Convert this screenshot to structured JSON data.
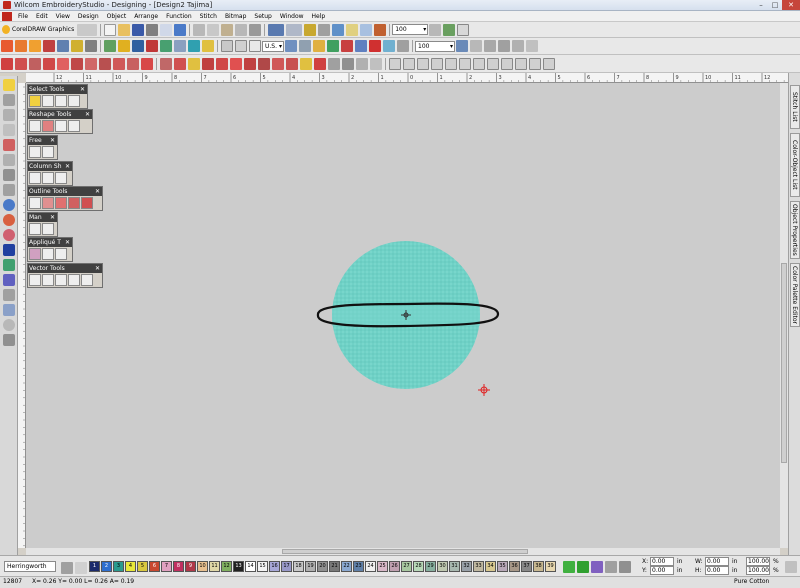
{
  "window": {
    "title": "Wilcom EmbroideryStudio - Designing - [Design2        Tajima]"
  },
  "menu": [
    "File",
    "Edit",
    "View",
    "Design",
    "Object",
    "Arrange",
    "Function",
    "Stitch",
    "Bitmap",
    "Setup",
    "Window",
    "Help"
  ],
  "toolbar": {
    "corel_label": "CorelDRAW Graphics",
    "zoom_value": "100",
    "units_value": "U.S.",
    "scale_value": "100"
  },
  "ruler": {
    "ticks": [
      "12",
      "11",
      "10",
      "9",
      "8",
      "7",
      "6",
      "5",
      "4",
      "3",
      "2",
      "1",
      "0",
      "1",
      "2",
      "3",
      "4",
      "5",
      "6",
      "7",
      "8",
      "9",
      "10",
      "11",
      "12"
    ]
  },
  "panels": [
    {
      "title": "Select Tools",
      "tools": 4
    },
    {
      "title": "Reshape Tools",
      "tools": 4
    },
    {
      "title": "Free",
      "tools": 2
    },
    {
      "title": "Column Sh",
      "tools": 3
    },
    {
      "title": "Outline Tools",
      "tools": 5
    },
    {
      "title": "Man",
      "tools": 2
    },
    {
      "title": "Appliqué T",
      "tools": 3
    },
    {
      "title": "Vector Tools",
      "tools": 5
    }
  ],
  "dock_tabs": [
    "Stitch List",
    "Color-Object List",
    "Object Properties",
    "Color Palette Editor"
  ],
  "fabric": {
    "value": "Herringworth"
  },
  "palette": [
    {
      "num": "1",
      "color": "#1b2a6b"
    },
    {
      "num": "2",
      "color": "#2f6fcf"
    },
    {
      "num": "3",
      "color": "#2a9a8e"
    },
    {
      "num": "4",
      "color": "#e8e83a"
    },
    {
      "num": "5",
      "color": "#d8c840"
    },
    {
      "num": "6",
      "color": "#c84830"
    },
    {
      "num": "7",
      "color": "#e0a0c0"
    },
    {
      "num": "8",
      "color": "#c03060"
    },
    {
      "num": "9",
      "color": "#b03848"
    },
    {
      "num": "10",
      "color": "#e8c090"
    },
    {
      "num": "11",
      "color": "#e0d8a8"
    },
    {
      "num": "12",
      "color": "#80b060"
    },
    {
      "num": "13",
      "color": "#202020"
    },
    {
      "num": "14",
      "color": "#ffffff"
    },
    {
      "num": "15",
      "color": "#f4f4f4"
    },
    {
      "num": "16",
      "color": "#a8a8d8"
    },
    {
      "num": "17",
      "color": "#9898c8"
    },
    {
      "num": "18",
      "color": "#c8c8c8"
    },
    {
      "num": "19",
      "color": "#b0b0b0"
    },
    {
      "num": "20",
      "color": "#909090"
    },
    {
      "num": "21",
      "color": "#787878"
    },
    {
      "num": "22",
      "color": "#8aa8d0"
    },
    {
      "num": "23",
      "color": "#6080a8"
    },
    {
      "num": "24",
      "color": "#f0f0f0"
    },
    {
      "num": "25",
      "color": "#d8b8c8"
    },
    {
      "num": "26",
      "color": "#c0a0b0"
    },
    {
      "num": "27",
      "color": "#a8c8a0"
    },
    {
      "num": "28",
      "color": "#b8d8b8"
    },
    {
      "num": "29",
      "color": "#88b0a0"
    },
    {
      "num": "30",
      "color": "#c0c8b0"
    },
    {
      "num": "31",
      "color": "#a8b8b0"
    },
    {
      "num": "32",
      "color": "#98a0a8"
    },
    {
      "num": "33",
      "color": "#c0b8a0"
    },
    {
      "num": "34",
      "color": "#d8c890"
    },
    {
      "num": "35",
      "color": "#b8a8b8"
    },
    {
      "num": "36",
      "color": "#a89888"
    },
    {
      "num": "37",
      "color": "#888888"
    },
    {
      "num": "38",
      "color": "#c8b890"
    },
    {
      "num": "39",
      "color": "#e8d8b0"
    }
  ],
  "coords": {
    "x": "0.00",
    "y": "0.00",
    "w": "0.00",
    "h": "0.00",
    "unit": "in",
    "pct_w": "100.00",
    "pct_h": "100.00",
    "pct_unit": "%"
  },
  "status": {
    "stitch_count": "12807",
    "coords_text": "X= 0.26 Y= 0.00 L= 0.26 A= 0.19",
    "thread": "Pure Cotton"
  },
  "colors": {
    "fill": "#6fd1c6",
    "outline": "#111111",
    "canvas": "#cccccc"
  }
}
